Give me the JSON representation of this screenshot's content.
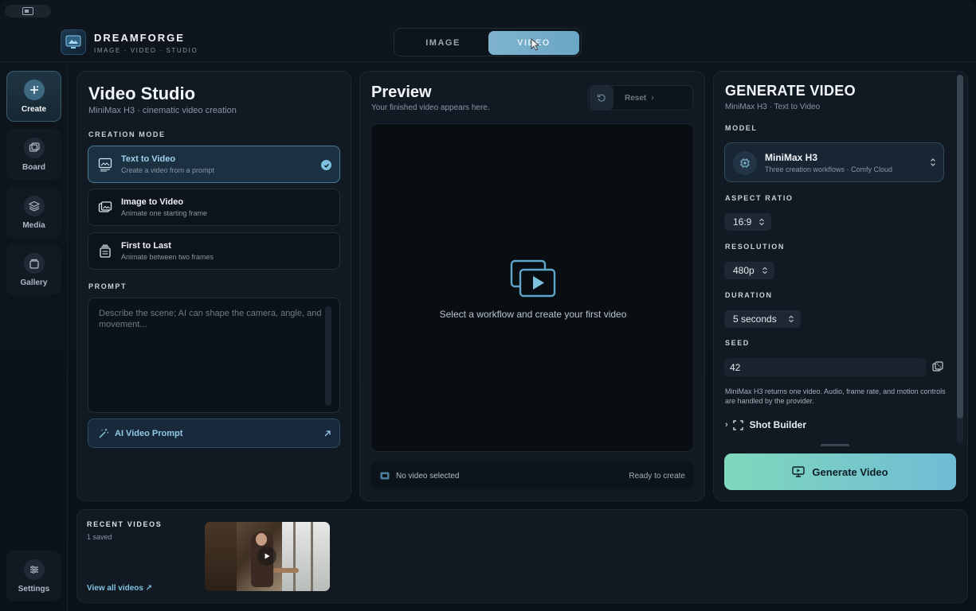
{
  "brand": {
    "name": "DREAMFORGE",
    "tagline": "IMAGE · VIDEO · STUDIO"
  },
  "mode_toggle": {
    "image_label": "IMAGE",
    "video_label": "VIDEO",
    "selected": "VIDEO"
  },
  "rail": {
    "items": [
      {
        "label": "Create",
        "icon": "sparkle-plus-icon",
        "active": true
      },
      {
        "label": "Board",
        "icon": "board-icon",
        "active": false
      },
      {
        "label": "Media",
        "icon": "layers-icon",
        "active": false
      },
      {
        "label": "Gallery",
        "icon": "gallery-icon",
        "active": false
      }
    ],
    "settings_label": "Settings"
  },
  "studio": {
    "title": "Video Studio",
    "subtitle": "MiniMax H3 · cinematic video creation",
    "creation_mode_label": "CREATION MODE",
    "workflows": [
      {
        "title": "Text to Video",
        "desc": "Create a video from a prompt",
        "icon": "text-image-icon",
        "selected": true
      },
      {
        "title": "Image to Video",
        "desc": "Animate one starting frame",
        "icon": "images-icon",
        "selected": false
      },
      {
        "title": "First to Last",
        "desc": "Animate between two frames",
        "icon": "frames-stack-icon",
        "selected": false
      }
    ],
    "prompt_label": "PROMPT",
    "prompt_placeholder": "Describe the scene; AI can shape the camera, angle, and movement...",
    "prompt_value": "",
    "ai_prompt_label": "AI Video Prompt"
  },
  "preview": {
    "title": "Preview",
    "subtitle": "Your finished video appears here.",
    "reset_label": "Reset",
    "empty_message": "Select a workflow and create your first video",
    "status_left": "No video selected",
    "status_right": "Ready to create"
  },
  "generate": {
    "title": "GENERATE VIDEO",
    "subtitle": "MiniMax H3 · Text to Video",
    "model_label": "MODEL",
    "model_name": "MiniMax H3",
    "model_desc": "Three creation workflows · Comfy Cloud",
    "aspect_label": "ASPECT RATIO",
    "aspect_value": "16:9",
    "resolution_label": "RESOLUTION",
    "resolution_value": "480p",
    "duration_label": "DURATION",
    "duration_value": "5 seconds",
    "seed_label": "SEED",
    "seed_value": "42",
    "note": "MiniMax H3 returns one video. Audio, frame rate, and motion controls are handled by the provider.",
    "shot_builder_label": "Shot Builder",
    "button_label": "Generate Video"
  },
  "recent": {
    "label": "RECENT VIDEOS",
    "count": "1 saved",
    "view_all": "View all videos ↗"
  },
  "colors": {
    "accent": "#7fc2e0",
    "generate_gradient_start": "#7fd8bb",
    "generate_gradient_end": "#70bcd6",
    "background": "#0b1118"
  }
}
